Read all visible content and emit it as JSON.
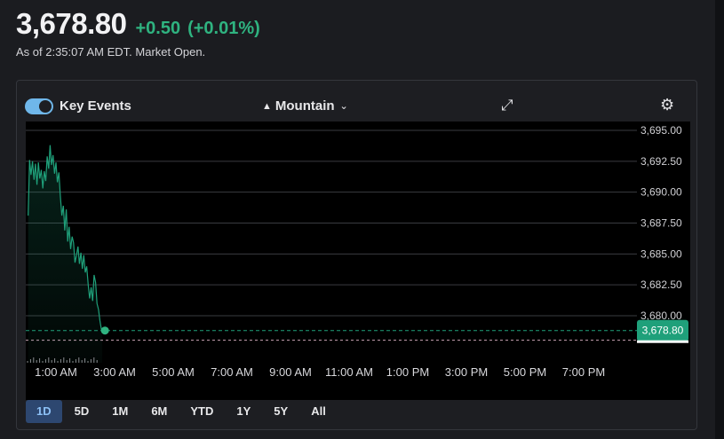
{
  "quote": {
    "price": "3,678.80",
    "change": "+0.50",
    "change_pct": "(+0.01%)",
    "as_of": "As of 2:35:07 AM EDT. Market Open."
  },
  "toolbar": {
    "key_events_label": "Key Events",
    "key_events_on": true,
    "chart_style_label": "Mountain"
  },
  "colors": {
    "up": "#2fb380",
    "line": "#1fa07a",
    "active_range_bg": "#2d4770",
    "active_range_text": "#8cc0f5"
  },
  "ranges": {
    "items": [
      "1D",
      "5D",
      "1M",
      "6M",
      "YTD",
      "1Y",
      "5Y",
      "All"
    ],
    "active": "1D"
  },
  "chart_data": {
    "type": "area",
    "title": "",
    "xlabel": "",
    "ylabel": "",
    "y_ticks": [
      "3,695.00",
      "3,692.50",
      "3,690.00",
      "3,687.50",
      "3,685.00",
      "3,682.50",
      "3,680.00"
    ],
    "y_tick_values": [
      3695.0,
      3692.5,
      3690.0,
      3687.5,
      3685.0,
      3682.5,
      3680.0
    ],
    "ylim": [
      3677.0,
      3695.0
    ],
    "x_ticks": [
      "1:00 AM",
      "3:00 AM",
      "5:00 AM",
      "7:00 AM",
      "9:00 AM",
      "11:00 AM",
      "1:00 PM",
      "3:00 PM",
      "5:00 PM",
      "7:00 PM"
    ],
    "x_tick_hours": [
      1,
      3,
      5,
      7,
      9,
      11,
      13,
      15,
      17,
      19
    ],
    "xlim_hours": [
      0.0,
      21.5
    ],
    "last_value_label": "3,678.80",
    "reference_line": 3678.3,
    "grid": true,
    "series": [
      {
        "x_hours": [
          0.05,
          0.1,
          0.15,
          0.2,
          0.25,
          0.3,
          0.35,
          0.4,
          0.45,
          0.5,
          0.55,
          0.6,
          0.65,
          0.7,
          0.75,
          0.8,
          0.85,
          0.9,
          0.95,
          1.0,
          1.05,
          1.1,
          1.15,
          1.2,
          1.25,
          1.3,
          1.35,
          1.4,
          1.45,
          1.5,
          1.55,
          1.6,
          1.65,
          1.7,
          1.75,
          1.8,
          1.85,
          1.9,
          1.95,
          2.0,
          2.05,
          2.1,
          2.15,
          2.2,
          2.25,
          2.3,
          2.35,
          2.4,
          2.45,
          2.5,
          2.55,
          2.58
        ],
        "values": [
          3688.1,
          3692.6,
          3691.4,
          3692.5,
          3691.0,
          3692.3,
          3690.6,
          3692.4,
          3691.1,
          3691.8,
          3690.3,
          3691.7,
          3690.9,
          3692.9,
          3691.9,
          3693.8,
          3692.2,
          3693.0,
          3691.5,
          3692.4,
          3690.8,
          3691.6,
          3689.7,
          3688.1,
          3688.9,
          3686.9,
          3688.6,
          3686.0,
          3687.2,
          3685.4,
          3686.4,
          3685.9,
          3684.3,
          3684.9,
          3685.6,
          3684.2,
          3685.1,
          3683.8,
          3684.9,
          3683.5,
          3684.0,
          3682.5,
          3681.4,
          3682.3,
          3681.2,
          3683.3,
          3682.7,
          3681.0,
          3680.5,
          3679.6,
          3678.9,
          3678.8
        ]
      }
    ]
  }
}
